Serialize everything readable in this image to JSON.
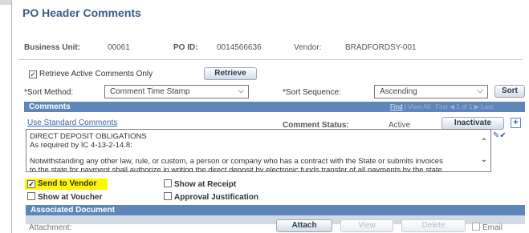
{
  "page": {
    "title": "PO Header Comments"
  },
  "header": {
    "business_unit_label": "Business Unit:",
    "business_unit_value": "00061",
    "po_id_label": "PO ID:",
    "po_id_value": "0014566636",
    "vendor_label": "Vendor:",
    "vendor_value": "BRADFORDSY-001"
  },
  "filter": {
    "retrieve_active_label": "Retrieve Active Comments Only",
    "retrieve_active_checked": "✓",
    "retrieve_button": "Retrieve",
    "sort_method_label": "*Sort Method:",
    "sort_method_value": "Comment Time Stamp",
    "sort_sequence_label": "*Sort Sequence:",
    "sort_sequence_value": "Ascending",
    "sort_button": "Sort"
  },
  "comments": {
    "header": "Comments",
    "nav_find": "Find",
    "nav_view_all": "View All",
    "nav_first": "First",
    "nav_counter": "1 of 1",
    "nav_last": "Last",
    "use_standard_link": "Use Standard Comments",
    "status_label": "Comment Status:",
    "status_value": "Active",
    "inactivate_button": "Inactivate",
    "add_button": "+",
    "text_line1": "DIRECT DEPOSIT OBLIGATIONS",
    "text_line2": "As required by IC 4-13-2-14.8:",
    "text_line3": "Notwithstanding any other law, rule, or custom, a person or company who has a contract with the State or submits invoices",
    "text_line4": "to the state for payment shall authorize in writing the direct deposit by electronic funds transfer of all payments by the state",
    "send_to_vendor_label": "Send to Vendor",
    "send_to_vendor_checked": "✓",
    "show_at_receipt_label": "Show at Receipt",
    "show_at_voucher_label": "Show at Voucher",
    "approval_justification_label": "Approval Justification"
  },
  "associated_document": {
    "header": "Associated Document",
    "attachment_label": "Attachment:",
    "attach_button": "Attach",
    "view_button": "View",
    "delete_button": "Delete",
    "email_label": "Email"
  },
  "colors": {
    "band": "#5f86bb",
    "title": "#3a5b86",
    "highlight": "#fff700"
  }
}
